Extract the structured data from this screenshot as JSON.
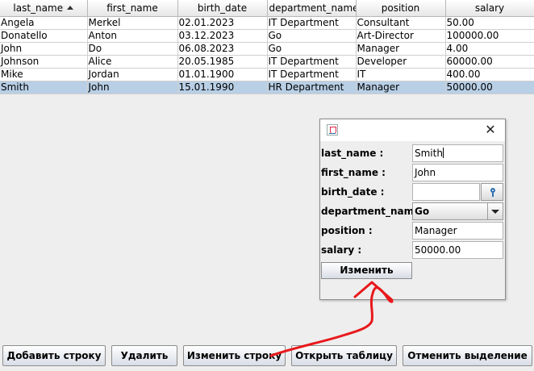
{
  "table": {
    "columns": [
      "last_name",
      "first_name",
      "birth_date",
      "department_name",
      "position",
      "salary"
    ],
    "sorted_column": "last_name",
    "rows": [
      [
        "Angela",
        "Merkel",
        "02.01.2023",
        "IT Department",
        "Consultant",
        "50.00"
      ],
      [
        "Donatello",
        "Anton",
        "03.12.2023",
        "Go",
        "Art-Director",
        "100000.00"
      ],
      [
        "John",
        "Do",
        "06.08.2023",
        "Go",
        "Manager",
        "4.00"
      ],
      [
        "Johnson",
        "Alice",
        "20.05.1985",
        "IT Department",
        "Developer",
        "60000.00"
      ],
      [
        "Mike",
        "Jordan",
        "01.01.1900",
        "IT Department",
        "IT",
        "400.00"
      ],
      [
        "Smith",
        "John",
        "15.01.1990",
        "HR Department",
        "Manager",
        "50000.00"
      ]
    ],
    "selected_row": 5
  },
  "dialog": {
    "close_glyph": "✕",
    "fields": {
      "last_name": {
        "label": "last_name :",
        "value": "Smith"
      },
      "first_name": {
        "label": "first_name :",
        "value": "John"
      },
      "birth_date": {
        "label": "birth_date :",
        "value": ""
      },
      "department_name": {
        "label": "department_name :",
        "value": "Go"
      },
      "position": {
        "label": "position :",
        "value": "Manager"
      },
      "salary": {
        "label": "salary :",
        "value": "50000.00"
      }
    },
    "submit_label": "Изменить"
  },
  "buttons": {
    "add_row": "Добавить строку",
    "delete": "Удалить",
    "edit_row": "Изменить строку",
    "open_table": "Открыть таблицу",
    "clear_selection": "Отменить выделение"
  },
  "colors": {
    "selection": "#b8cfe5",
    "annotation": "#e8191c"
  },
  "icons": {
    "window_icon": "java-cup-icon",
    "date_picker": "key-icon",
    "combo": "chevron-down-icon"
  }
}
